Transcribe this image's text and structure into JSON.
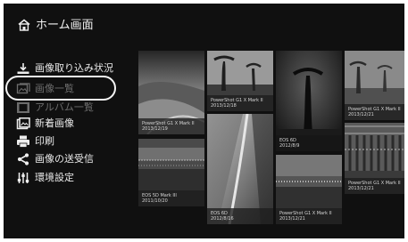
{
  "header": {
    "title": "ホーム画面",
    "icon": "home-icon"
  },
  "sidebar": {
    "items": [
      {
        "label": "画像取り込み状況",
        "icon": "import-icon"
      },
      {
        "label": "画像一覧",
        "icon": "image-list-icon"
      },
      {
        "label": "アルバム一覧",
        "icon": "album-icon"
      },
      {
        "label": "新着画像",
        "icon": "new-images-icon"
      },
      {
        "label": "印刷",
        "icon": "printer-icon"
      },
      {
        "label": "画像の送受信",
        "icon": "share-icon"
      },
      {
        "label": "環境設定",
        "icon": "settings-icon"
      }
    ],
    "highlighted_item": "画像一覧"
  },
  "gallery": {
    "tiles": [
      {
        "camera": "PowerShot G1 X Mark II",
        "date": "2013/12/19"
      },
      {
        "camera": "PowerShot G1 X Mark II",
        "date": "2013/12/18"
      },
      {
        "camera": "EOS 6D",
        "date": "2012/8/9"
      },
      {
        "camera": "PowerShot G1 X Mark II",
        "date": "2013/12/21"
      },
      {
        "camera": "EOS 5D Mark III",
        "date": "2011/10/20"
      },
      {
        "camera": "EOS 6D",
        "date": "2012/8/16"
      },
      {
        "camera": "PowerShot G1 X Mark II",
        "date": "2013/12/21"
      },
      {
        "camera": "PowerShot G1 X Mark II",
        "date": "2013/12/21"
      }
    ]
  },
  "colors": {
    "background": "#101010",
    "text": "#eaeaea",
    "dimmed_text": "#6d6d6d",
    "highlight_ring": "#f4f4f4"
  }
}
